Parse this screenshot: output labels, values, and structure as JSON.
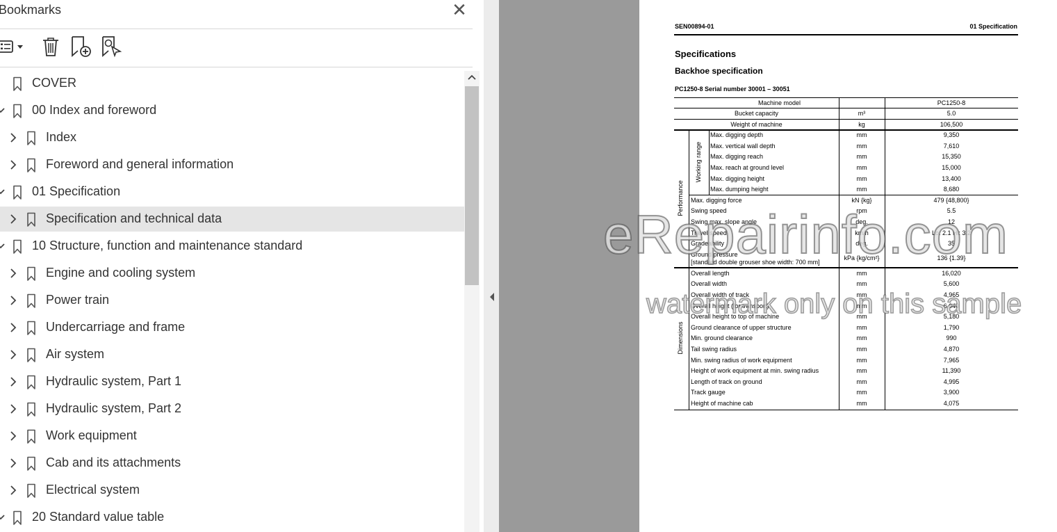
{
  "panel": {
    "title": "Bookmarks",
    "close_icon": "close-icon"
  },
  "toolbar": {
    "options_icon": "bookmark-options-icon",
    "delete_icon": "trash-icon",
    "add_icon": "new-bookmark-icon",
    "find_icon": "find-current-bookmark-icon"
  },
  "bookmarks": [
    {
      "label": "COVER",
      "level": 0,
      "state": "none"
    },
    {
      "label": "00 Index and foreword",
      "level": 0,
      "state": "expanded"
    },
    {
      "label": "Index",
      "level": 1,
      "state": "collapsed"
    },
    {
      "label": "Foreword and general information",
      "level": 1,
      "state": "collapsed"
    },
    {
      "label": "01 Specification",
      "level": 0,
      "state": "expanded"
    },
    {
      "label": "Specification and technical data",
      "level": 1,
      "state": "collapsed",
      "selected": true
    },
    {
      "label": "10 Structure, function and maintenance standard",
      "level": 0,
      "state": "expanded"
    },
    {
      "label": "Engine and cooling system",
      "level": 1,
      "state": "collapsed"
    },
    {
      "label": "Power train",
      "level": 1,
      "state": "collapsed"
    },
    {
      "label": "Undercarriage and frame",
      "level": 1,
      "state": "collapsed"
    },
    {
      "label": "Air system",
      "level": 1,
      "state": "collapsed"
    },
    {
      "label": "Hydraulic system, Part 1",
      "level": 1,
      "state": "collapsed"
    },
    {
      "label": "Hydraulic system, Part 2",
      "level": 1,
      "state": "collapsed"
    },
    {
      "label": "Work equipment",
      "level": 1,
      "state": "collapsed"
    },
    {
      "label": "Cab and its attachments",
      "level": 1,
      "state": "collapsed"
    },
    {
      "label": "Electrical system",
      "level": 1,
      "state": "collapsed"
    },
    {
      "label": "20 Standard value table",
      "level": 0,
      "state": "expanded"
    }
  ],
  "document": {
    "doc_id": "SEN00894-01",
    "section": "01 Specification",
    "title": "Specifications",
    "subtitle": "Backhoe specification",
    "serial_line": "PC1250-8 Serial number 30001 – 30051",
    "table": {
      "header": {
        "label": "Machine model",
        "value": "PC1250-8"
      },
      "top_rows": [
        {
          "label": "Bucket capacity",
          "unit": "m³",
          "value": "5.0"
        },
        {
          "label": "Weight of machine",
          "unit": "kg",
          "value": "106,500"
        }
      ],
      "group_performance": "Performance",
      "group_working_range": "Working range",
      "working_range_rows": [
        {
          "label": "Max. digging depth",
          "unit": "mm",
          "value": "9,350"
        },
        {
          "label": "Max. vertical wall depth",
          "unit": "mm",
          "value": "7,610"
        },
        {
          "label": "Max. digging reach",
          "unit": "mm",
          "value": "15,350"
        },
        {
          "label": "Max. reach at ground level",
          "unit": "mm",
          "value": "15,000"
        },
        {
          "label": "Max. digging height",
          "unit": "mm",
          "value": "13,400"
        },
        {
          "label": "Max. dumping height",
          "unit": "mm",
          "value": "8,680"
        }
      ],
      "performance_rows": [
        {
          "label": "Max. digging force",
          "unit": "kN {kg}",
          "value": "479 {48,800}"
        },
        {
          "label": "Swing speed",
          "unit": "rpm",
          "value": "5.5"
        },
        {
          "label": "Swing max. slope angle",
          "unit": "deg.",
          "value": "12"
        },
        {
          "label": "Travel speed",
          "unit": "km/h",
          "value": "Lo: 2.1  Hi: 3.2"
        },
        {
          "label": "Gradeability",
          "unit": "deg.",
          "value": "35"
        }
      ],
      "ground_pressure": {
        "label": "Ground pressure",
        "note": "[standard double grouser shoe width: 700 mm]",
        "unit": "kPa {kg/cm²}",
        "value": "136 {1.39}"
      },
      "group_dimensions": "Dimensions",
      "dimension_rows": [
        {
          "label": "Overall length",
          "unit": "mm",
          "value": "16,020"
        },
        {
          "label": "Overall width",
          "unit": "mm",
          "value": "5,600"
        },
        {
          "label": "Overall width of track",
          "unit": "mm",
          "value": "4,965"
        },
        {
          "label": "Overall height (for transport)",
          "unit": "mm",
          "value": "6,040"
        },
        {
          "label": "Overall height to top of machine",
          "unit": "mm",
          "value": "5,180"
        },
        {
          "label": "Ground clearance of upper structure",
          "unit": "mm",
          "value": "1,790"
        },
        {
          "label": "Min. ground clearance",
          "unit": "mm",
          "value": "990"
        },
        {
          "label": "Tail swing radius",
          "unit": "mm",
          "value": "4,870"
        },
        {
          "label": "Min. swing radius of work equipment",
          "unit": "mm",
          "value": "7,965"
        },
        {
          "label": "Height of work equipment at min. swing radius",
          "unit": "mm",
          "value": "11,390"
        },
        {
          "label": "Length of track on ground",
          "unit": "mm",
          "value": "4,995"
        },
        {
          "label": "Track gauge",
          "unit": "mm",
          "value": "3,900"
        },
        {
          "label": "Height of machine cab",
          "unit": "mm",
          "value": "4,075"
        }
      ]
    }
  },
  "watermark": {
    "line1": "eRepairinfo.com",
    "line2": "watermark only on this sample"
  },
  "colors": {
    "selected_row": "#e5e5e5",
    "gray_background": "#9a9a9a",
    "scroll_thumb": "#c2c2c2"
  }
}
